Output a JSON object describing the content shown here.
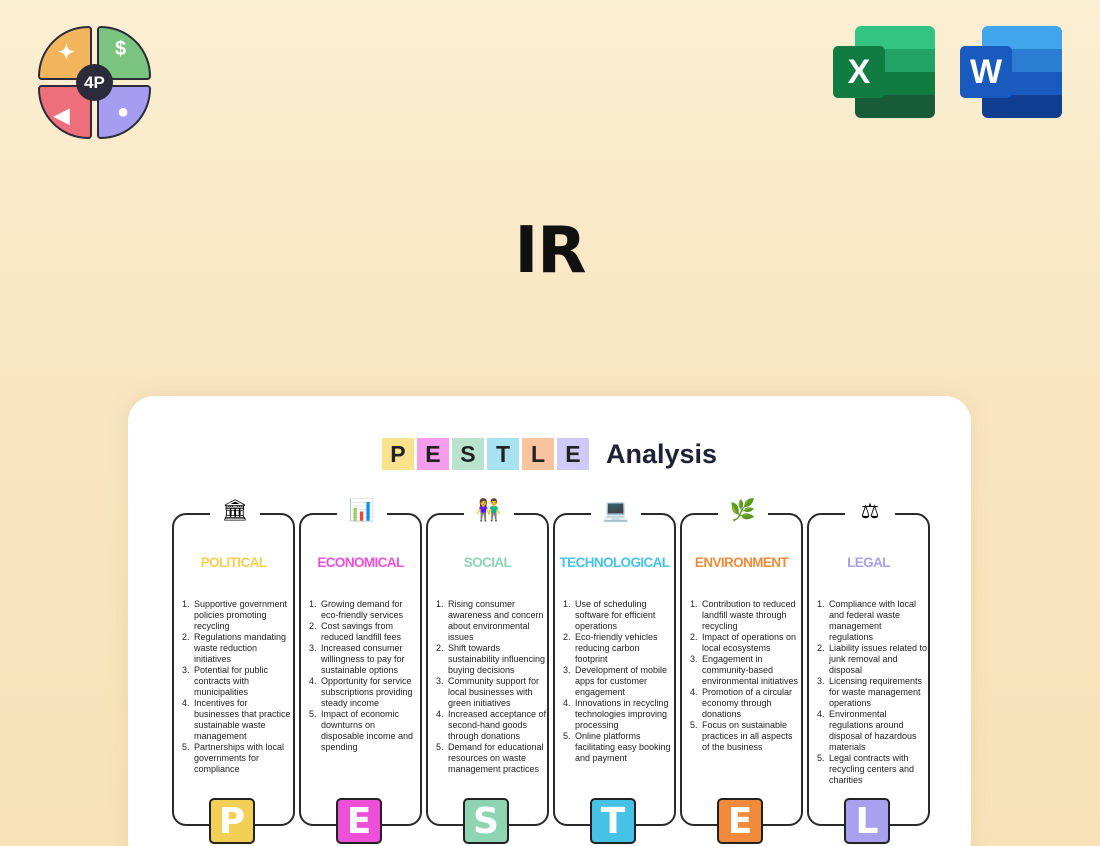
{
  "logo": {
    "center_text": "4P",
    "colors": [
      "#f3b55b",
      "#7bc47f",
      "#ee6f7c",
      "#a69cf0"
    ]
  },
  "apps": [
    {
      "name": "excel-icon",
      "letter": "X",
      "color": "#107c41"
    },
    {
      "name": "word-icon",
      "letter": "W",
      "color": "#185abd"
    }
  ],
  "title": "IR",
  "card": {
    "header_letters": [
      {
        "letter": "P",
        "color": "#f9e28b"
      },
      {
        "letter": "E",
        "color": "#f59ced"
      },
      {
        "letter": "S",
        "color": "#b9e3cf"
      },
      {
        "letter": "T",
        "color": "#a8e1f0"
      },
      {
        "letter": "L",
        "color": "#f8c39f"
      },
      {
        "letter": "E",
        "color": "#cfcaf8"
      }
    ],
    "header_word": "Analysis",
    "columns": [
      {
        "icon": "bank-icon",
        "glyph": "🏛",
        "heading": "POLITICAL",
        "color": "#f4cf55",
        "letter": "P",
        "items": [
          "Supportive government policies promoting recycling",
          "Regulations mandating waste reduction initiatives",
          "Potential for public contracts with municipalities",
          "Incentives for businesses that practice sustainable waste management",
          "Partnerships with local governments for compliance"
        ]
      },
      {
        "icon": "bar-chart-icon",
        "glyph": "📊",
        "heading": "ECONOMICAL",
        "color": "#ee4fd8",
        "letter": "E",
        "items": [
          "Growing demand for eco-friendly services",
          "Cost savings from reduced landfill fees",
          "Increased consumer willingness to pay for sustainable options",
          "Opportunity for service subscriptions providing steady income",
          "Impact of economic downturns on disposable income and spending"
        ]
      },
      {
        "icon": "people-icon",
        "glyph": "👫",
        "heading": "SOCIAL",
        "color": "#8fd4b2",
        "letter": "S",
        "items": [
          "Rising consumer awareness and concern about environmental issues",
          "Shift towards sustainability influencing buying decisions",
          "Community support for local businesses with green initiatives",
          "Increased acceptance of second-hand goods through donations",
          "Demand for educational resources on waste management practices"
        ]
      },
      {
        "icon": "laptop-icon",
        "glyph": "💻",
        "heading": "TECHNOLOGICAL",
        "color": "#45c2e6",
        "letter": "T",
        "items": [
          "Use of scheduling software for efficient operations",
          "Eco-friendly vehicles reducing carbon footprint",
          "Development of mobile apps for customer engagement",
          "Innovations in recycling technologies improving processing",
          "Online platforms facilitating easy booking and payment"
        ]
      },
      {
        "icon": "leaf-icon",
        "glyph": "🌿",
        "heading": "ENVIRONMENT",
        "color": "#f28a3c",
        "letter": "E",
        "items": [
          "Contribution to reduced landfill waste through recycling",
          "Impact of operations on local ecosystems",
          "Engagement in community-based environmental initiatives",
          "Promotion of a circular economy through donations",
          "Focus on sustainable practices in all aspects of the business"
        ]
      },
      {
        "icon": "scales-icon",
        "glyph": "⚖",
        "heading": "LEGAL",
        "color": "#a9a0f0",
        "letter": "L",
        "items": [
          "Compliance with local and federal waste management regulations",
          "Liability issues related to junk removal and disposal",
          "Licensing requirements for waste management operations",
          "Environmental regulations around disposal of hazardous materials",
          "Legal contracts with recycling centers and charities"
        ]
      }
    ]
  }
}
